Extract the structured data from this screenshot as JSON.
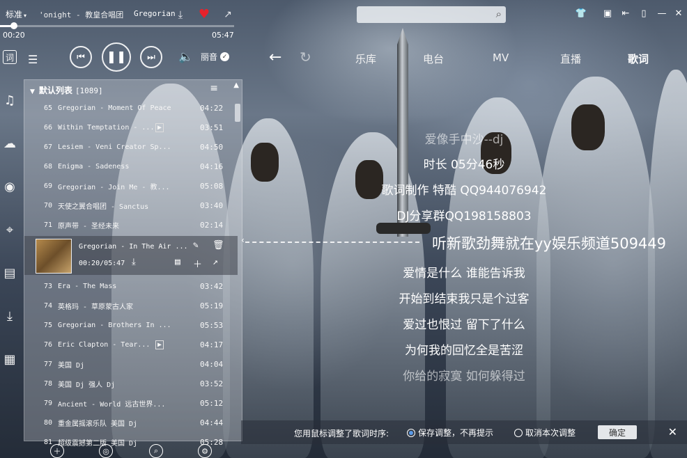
{
  "topbar": {
    "quality": "标准",
    "song_title": "'onight - 教皇合唱团",
    "artist": "Gregorian",
    "time_current": "00:20",
    "time_total": "05:47",
    "progress_fraction": 0.06
  },
  "search": {
    "placeholder": ""
  },
  "player": {
    "sound_effect": "丽音"
  },
  "sidebar": {
    "lyric_label": "词"
  },
  "nav": {
    "tabs": [
      {
        "label": "乐库"
      },
      {
        "label": "电台"
      },
      {
        "label": "MV"
      },
      {
        "label": "直播"
      },
      {
        "label": "歌词"
      }
    ],
    "active_index": 4
  },
  "playlist": {
    "title": "默认列表",
    "count": "[1089]",
    "rows_before": [
      {
        "num": "65",
        "name": "Gregorian - Moment Of Peace",
        "duration": "04:22"
      },
      {
        "num": "66",
        "name": "Within Temptation - ...",
        "duration": "03:51",
        "mv": true
      },
      {
        "num": "67",
        "name": "Lesiem - Veni Creator Sp...",
        "duration": "04:50"
      },
      {
        "num": "68",
        "name": "Enigma - Sadeness",
        "duration": "04:16"
      },
      {
        "num": "69",
        "name": "Gregorian - Join Me - 教...",
        "duration": "05:08"
      },
      {
        "num": "70",
        "name": "天使之翼合唱团 - Sanctus",
        "duration": "03:40"
      },
      {
        "num": "71",
        "name": "原声带 - 圣经未来",
        "duration": "02:14"
      }
    ],
    "now_playing": {
      "name": "Gregorian - In The Air ...",
      "time": "00:20/05:47"
    },
    "rows_after": [
      {
        "num": "73",
        "name": "Era - The Mass",
        "duration": "03:42"
      },
      {
        "num": "74",
        "name": "英格玛 - 草原蒙古人家",
        "duration": "05:19"
      },
      {
        "num": "75",
        "name": "Gregorian - Brothers In ...",
        "duration": "05:53"
      },
      {
        "num": "76",
        "name": "Eric Clapton - Tear...",
        "duration": "04:17",
        "mv": true
      },
      {
        "num": "77",
        "name": "美国 Dj",
        "duration": "04:04"
      },
      {
        "num": "78",
        "name": "美国 Dj 强人 Dj",
        "duration": "03:52"
      },
      {
        "num": "79",
        "name": "Ancient - World 远古世界...",
        "duration": "05:12"
      },
      {
        "num": "80",
        "name": "重金属摇滚乐队 美国 Dj",
        "duration": "04:44"
      },
      {
        "num": "81",
        "name": "超级震撼第二版 美国 Dj",
        "duration": "05:28"
      }
    ]
  },
  "lyrics": [
    {
      "text": "爱像手中沙--dj",
      "style": "dim"
    },
    {
      "text": "时长 05分46秒",
      "style": "normal"
    },
    {
      "text": "歌词制作 特酷 QQ944076942",
      "style": "normal"
    },
    {
      "text": "DJ分享群QQ198158803",
      "style": "normal"
    },
    {
      "text": "听新歌劲舞就在yy娱乐频道509449",
      "style": "cur"
    },
    {
      "text": "爱情是什么 谁能告诉我",
      "style": "normal"
    },
    {
      "text": "开始到结束我只是个过客",
      "style": "normal"
    },
    {
      "text": "爱过也恨过 留下了什么",
      "style": "normal"
    },
    {
      "text": "为何我的回忆全是苦涩",
      "style": "normal"
    },
    {
      "text": "你给的寂寞 如何躲得过",
      "style": "dim"
    }
  ],
  "notice": {
    "text": "您用鼠标调整了歌词时序:",
    "option_save": "保存调整，不再提示",
    "option_cancel": "取消本次调整",
    "confirm": "确定"
  }
}
